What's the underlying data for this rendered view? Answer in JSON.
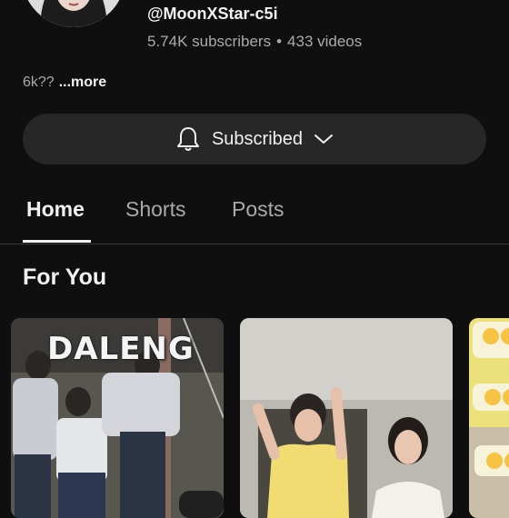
{
  "channel": {
    "handle": "@MoonXStar-c5i",
    "subscribers": "5.74K subscribers",
    "separator": "•",
    "videos": "433 videos",
    "description": "6k??",
    "more_label": "...more"
  },
  "subscribe_button": {
    "label": "Subscribed"
  },
  "tabs": [
    {
      "label": "Home",
      "active": true
    },
    {
      "label": "Shorts",
      "active": false
    },
    {
      "label": "Posts",
      "active": false
    }
  ],
  "section": {
    "title": "For You"
  },
  "videos": [
    {
      "thumbnail_title": "DALENG"
    },
    {
      "thumbnail_title": ""
    },
    {
      "thumbnail_title": ""
    }
  ],
  "colors": {
    "background": "#0f0f0f",
    "button": "#272727",
    "text_secondary": "#aaaaaa"
  },
  "icons": {
    "bell": "bell-icon",
    "chevron": "chevron-down-icon"
  }
}
